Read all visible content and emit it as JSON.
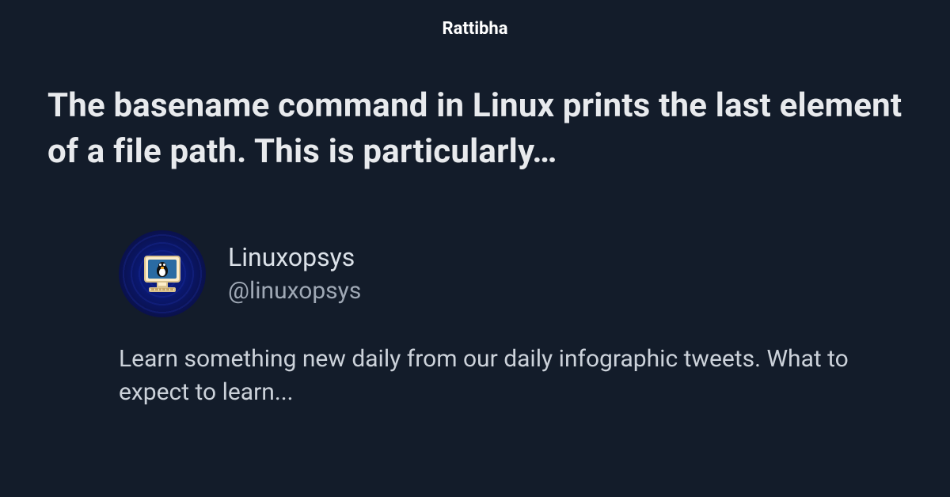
{
  "site": {
    "title": "Rattibha"
  },
  "post": {
    "heading": "The basename command in Linux prints the last element of a file path. This is particularly…"
  },
  "profile": {
    "display_name": "Linuxopsys",
    "handle": "@linuxopsys",
    "bio": "Learn something new daily from our daily infographic tweets. What to expect to learn..."
  }
}
